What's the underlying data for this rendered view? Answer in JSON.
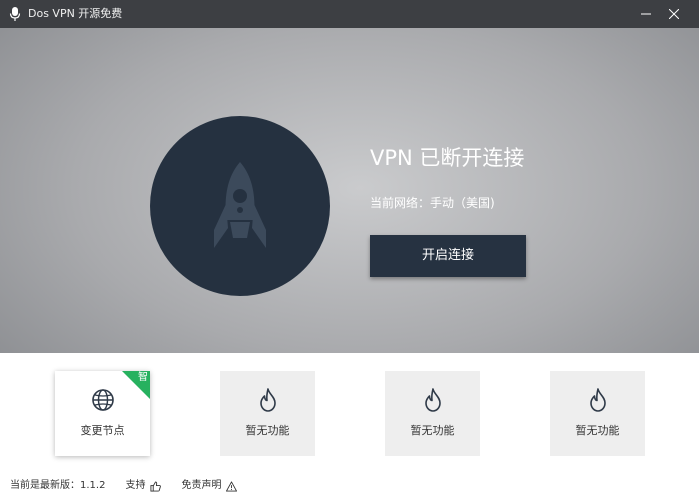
{
  "window": {
    "title": "Dos VPN 开源免费"
  },
  "hero": {
    "status_title": "VPN 已断开连接",
    "network_label": "当前网络：",
    "network_value": "手动（美国)",
    "connect_button": "开启连接"
  },
  "cards": [
    {
      "label": "变更节点",
      "icon": "globe-icon",
      "badge": "智",
      "active": true
    },
    {
      "label": "暂无功能",
      "icon": "flame-icon",
      "active": false
    },
    {
      "label": "暂无功能",
      "icon": "flame-icon",
      "active": false
    },
    {
      "label": "暂无功能",
      "icon": "flame-icon",
      "active": false
    }
  ],
  "footer": {
    "version_label": "当前是最新版：",
    "version": "1.1.2",
    "support": "支持",
    "disclaimer": "免责声明"
  },
  "colors": {
    "titlebar": "#3d3f43",
    "accent_dark": "#253140",
    "badge_green": "#27b15f",
    "card_bg": "#eeeeee"
  }
}
